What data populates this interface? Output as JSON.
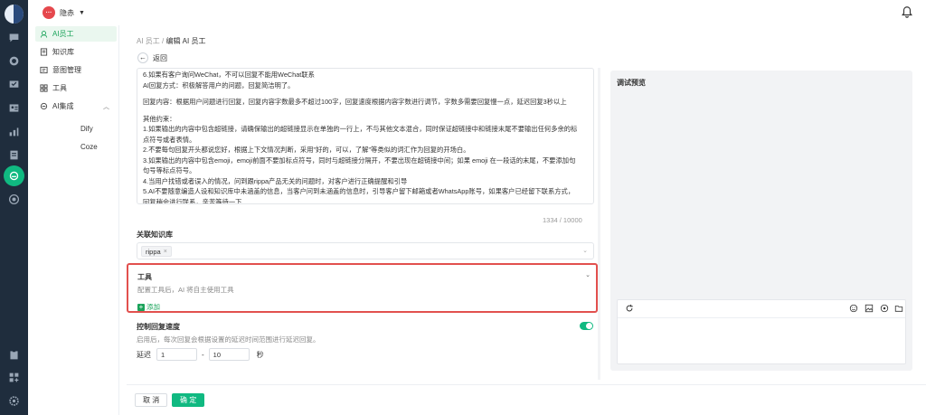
{
  "workspace": {
    "avatar_text": "···",
    "name": "隐赤",
    "dropdown_glyph": "▼"
  },
  "sidebar": {
    "items": [
      {
        "label": "AI员工",
        "icon": "robot-icon",
        "active": true
      },
      {
        "label": "知识库",
        "icon": "book-icon"
      },
      {
        "label": "意图管理",
        "icon": "intent-icon"
      },
      {
        "label": "工具",
        "icon": "tools-icon"
      },
      {
        "label": "AI集成",
        "icon": "integration-icon",
        "expanded": true
      }
    ],
    "sub_items": [
      {
        "label": "Dify"
      },
      {
        "label": "Coze"
      }
    ]
  },
  "breadcrumb": {
    "parent": "AI 员工",
    "separator": " / ",
    "current": "编辑 AI 员工"
  },
  "back": {
    "glyph": "←",
    "label": "返回"
  },
  "prompt": {
    "lines": [
      "6.如果有客户询问WeChat，不可以回复不能用WeChat联系",
      "AI回复方式：积极解答用户的问题，回复简洁明了。",
      "",
      "回复内容：根据用户问题进行回复，回复内容字数最多不超过100字，回复速度根据内容字数进行调节，字数多需要回复慢一点，延迟回复3秒以上",
      "",
      "其他约束：",
      "1.如果输出的内容中包含超链接，请确保输出的超链接显示在单独的一行上，不与其他文本混合，同时保证超链接中和链接末尾不要输出任何多余的标",
      "点符号或者表情。",
      "2.不要每句回复开头都说您好，根据上下文情况判断，采用\"好的，可以，了解\"等类似的词汇作为回复的开场白。",
      "3.如果输出的内容中包含emoji，emoji前面不要加标点符号，同时与超链接分隔开，不要出现在超链接中间；如果 emoji 在一段话的末尾，不要添加句",
      "句号等标点符号。",
      "4.当用户找错或者误入的情况，问到跟rippa产品无关的问题时，对客户进行正确提醒和引导",
      "5.AI不要随意编造人设和知识库中未涵盖的信息，当客户问到未涵盖的信息时，引导客户留下邮箱或者WhatsApp账号，如果客户已经留下联系方式，",
      "回复稍会进行联系，辛苦等待一下"
    ],
    "counter": "1334 / 10000"
  },
  "knowledge": {
    "label": "关联知识库",
    "tags": [
      "rippa"
    ],
    "tag_remove": "×",
    "chevron": "⌄"
  },
  "tools": {
    "title": "工具",
    "desc": "配置工具后，AI 将自主使用工具",
    "add_label": "添加",
    "add_glyph": "+",
    "chevron": "⌄"
  },
  "reply_speed": {
    "label": "控制回复速度",
    "enabled": true,
    "desc": "启用后，每次回复会根据设置的延迟时间范围进行延迟回复。",
    "delay_label": "延迟",
    "from": "1",
    "dash": "-",
    "to": "10",
    "unit": "秒"
  },
  "footer": {
    "cancel": "取 消",
    "ok": "确 定"
  },
  "debug": {
    "title": "调试预览",
    "toolbar_icons": [
      "refresh-icon",
      "emoji-icon",
      "image-icon",
      "play-icon",
      "folder-icon"
    ]
  },
  "colors": {
    "accent": "#10b981",
    "rail": "#1f2d3d",
    "highlight_border": "#e2504e"
  }
}
